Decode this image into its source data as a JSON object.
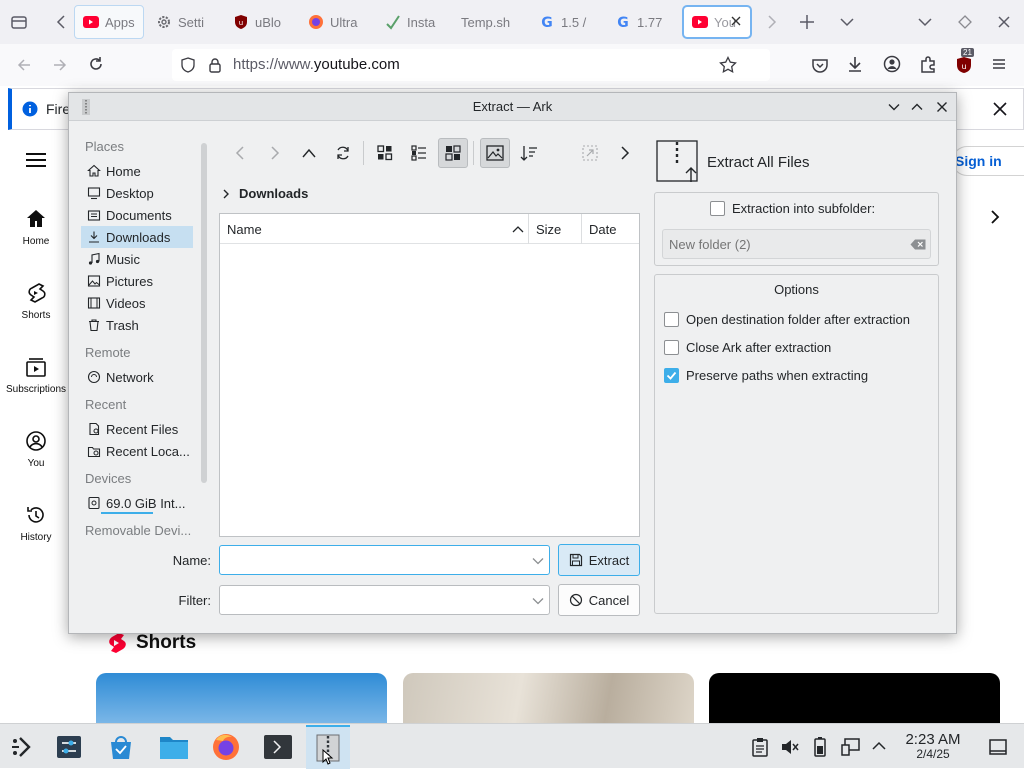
{
  "browser": {
    "tabs": [
      {
        "label": "Apps",
        "icon": "youtube-icon"
      },
      {
        "label": "Setti",
        "icon": "gear-icon"
      },
      {
        "label": "uBlo",
        "icon": "ublock-icon"
      },
      {
        "label": "Ultra",
        "icon": "firefox-icon"
      },
      {
        "label": "Insta",
        "icon": "instaloader-icon"
      },
      {
        "label": "Temp.sh",
        "icon": ""
      },
      {
        "label": "1.5 /",
        "icon": "google-icon"
      },
      {
        "label": "1.77",
        "icon": "google-icon"
      },
      {
        "label": "You",
        "icon": "youtube-icon"
      }
    ],
    "url_prefix": "https://www.",
    "url_domain": "youtube.com",
    "extensions_badge": "21",
    "infobar_text": "Fire"
  },
  "youtube": {
    "sign_in": "Sign in",
    "nav": [
      "Home",
      "Shorts",
      "Subscriptions",
      "You",
      "History"
    ],
    "section_title": "Shorts"
  },
  "dialog": {
    "title": "Extract — Ark",
    "places_header": "Places",
    "places": [
      "Home",
      "Desktop",
      "Documents",
      "Downloads",
      "Music",
      "Pictures",
      "Videos",
      "Trash"
    ],
    "remote_header": "Remote",
    "remote": [
      "Network"
    ],
    "recent_header": "Recent",
    "recent": [
      "Recent Files",
      "Recent Loca..."
    ],
    "devices_header": "Devices",
    "devices": [
      "69.0 GiB Int..."
    ],
    "removable_header": "Removable Devi...",
    "breadcrumb": "Downloads",
    "columns": {
      "name": "Name",
      "size": "Size",
      "date": "Date"
    },
    "name_label": "Name:",
    "name_value": "",
    "filter_label": "Filter:",
    "filter_value": "",
    "extract_button": "Extract",
    "cancel_button": "Cancel",
    "extract_all": "Extract All Files",
    "subfolder_label": "Extraction into subfolder:",
    "subfolder_placeholder": "New folder (2)",
    "options_title": "Options",
    "options": [
      {
        "label": "Open destination folder after extraction",
        "checked": false
      },
      {
        "label": "Close Ark after extraction",
        "checked": false
      },
      {
        "label": "Preserve paths when extracting",
        "checked": true
      }
    ]
  },
  "taskbar": {
    "time": "2:23 AM",
    "date": "2/4/25"
  },
  "colors": {
    "accent": "#3daee9",
    "selection": "#c6dff1",
    "youtube_red": "#ff0033"
  }
}
